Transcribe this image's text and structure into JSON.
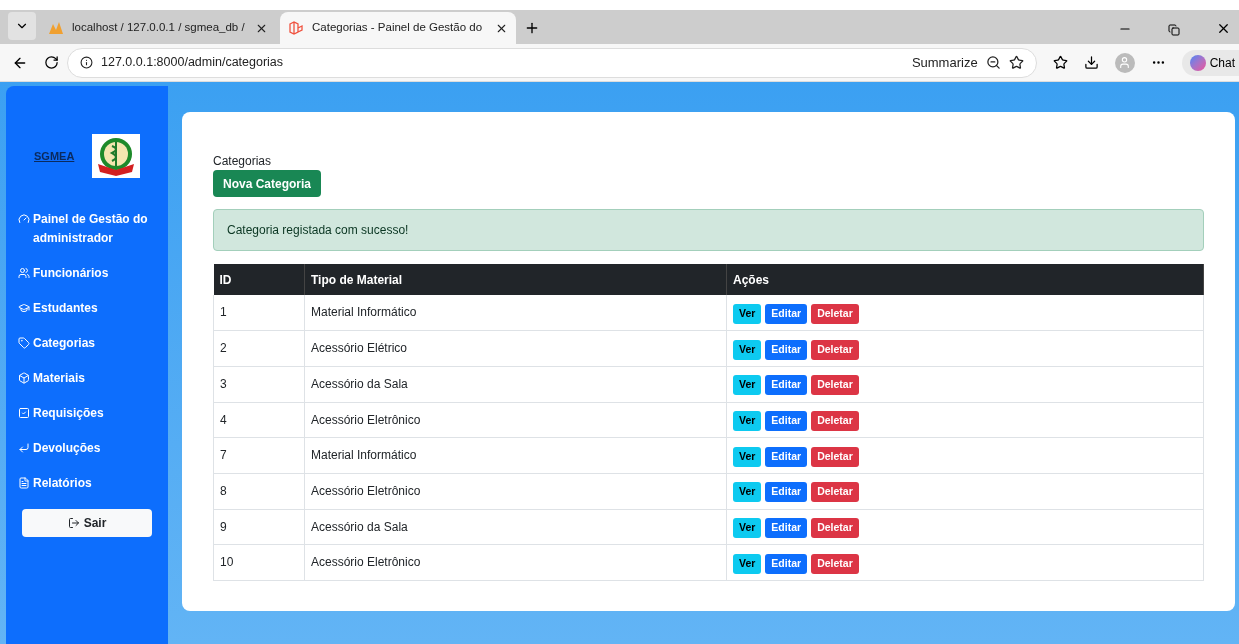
{
  "browser": {
    "tabs": [
      {
        "title": "localhost / 127.0.0.1 / sgmea_db /",
        "selected": false,
        "kind": "pma"
      },
      {
        "title": "Categorias - Painel de Gestão do",
        "selected": true,
        "kind": "laravel"
      }
    ],
    "url": "127.0.0.1:8000/admin/categorias",
    "summarize": "Summarize",
    "chat": "Chat"
  },
  "sidebar": {
    "logo_text": "SGMEA",
    "items": [
      {
        "label": "Painel de Gestão do administrador"
      },
      {
        "label": "Funcionários"
      },
      {
        "label": "Estudantes"
      },
      {
        "label": "Categorias"
      },
      {
        "label": "Materiais"
      },
      {
        "label": "Requisições"
      },
      {
        "label": "Devoluções"
      },
      {
        "label": "Relatórios"
      }
    ],
    "logout": "Sair"
  },
  "page": {
    "heading": "Categorias",
    "new_button": "Nova Categoria",
    "alert": "Categoria registada com sucesso!",
    "table": {
      "columns": [
        "ID",
        "Tipo de Material",
        "Ações"
      ],
      "rows": [
        {
          "id": "1",
          "type": "Material Informático",
          "actions": [
            {
              "label": "Ver",
              "kind": "info"
            },
            {
              "label": "Editar",
              "kind": "primary"
            },
            {
              "label": "Deletar",
              "kind": "danger"
            }
          ]
        },
        {
          "id": "2",
          "type": "Acessório Elétrico",
          "actions": [
            {
              "label": "Ver",
              "kind": "info"
            },
            {
              "label": "Editar",
              "kind": "primary"
            },
            {
              "label": "Deletar",
              "kind": "danger"
            }
          ]
        },
        {
          "id": "3",
          "type": "Acessório da Sala",
          "actions": [
            {
              "label": "Ver",
              "kind": "info"
            },
            {
              "label": "Editar",
              "kind": "primary"
            },
            {
              "label": "Deletar",
              "kind": "danger"
            }
          ]
        },
        {
          "id": "4",
          "type": "Acessório Eletrônico",
          "actions": [
            {
              "label": "Ver",
              "kind": "info"
            },
            {
              "label": "Editar",
              "kind": "primary"
            },
            {
              "label": "Deletar",
              "kind": "danger"
            }
          ]
        },
        {
          "id": "7",
          "type": "Material Informático",
          "actions": [
            {
              "label": "Ver",
              "kind": "info"
            },
            {
              "label": "Editar",
              "kind": "primary"
            },
            {
              "label": "Deletar",
              "kind": "danger"
            }
          ]
        },
        {
          "id": "8",
          "type": "Acessório Eletrônico",
          "actions": [
            {
              "label": "Ver",
              "kind": "info"
            },
            {
              "label": "Editar",
              "kind": "primary"
            },
            {
              "label": "Deletar",
              "kind": "danger"
            }
          ]
        },
        {
          "id": "9",
          "type": "Acessório da Sala",
          "actions": [
            {
              "label": "Ver",
              "kind": "info"
            },
            {
              "label": "Editar",
              "kind": "primary"
            },
            {
              "label": "Deletar",
              "kind": "danger"
            }
          ]
        },
        {
          "id": "10",
          "type": "Acessório Eletrônico",
          "actions": [
            {
              "label": "Ver",
              "kind": "info"
            },
            {
              "label": "Editar",
              "kind": "primary"
            },
            {
              "label": "Deletar",
              "kind": "danger"
            }
          ]
        }
      ]
    }
  }
}
